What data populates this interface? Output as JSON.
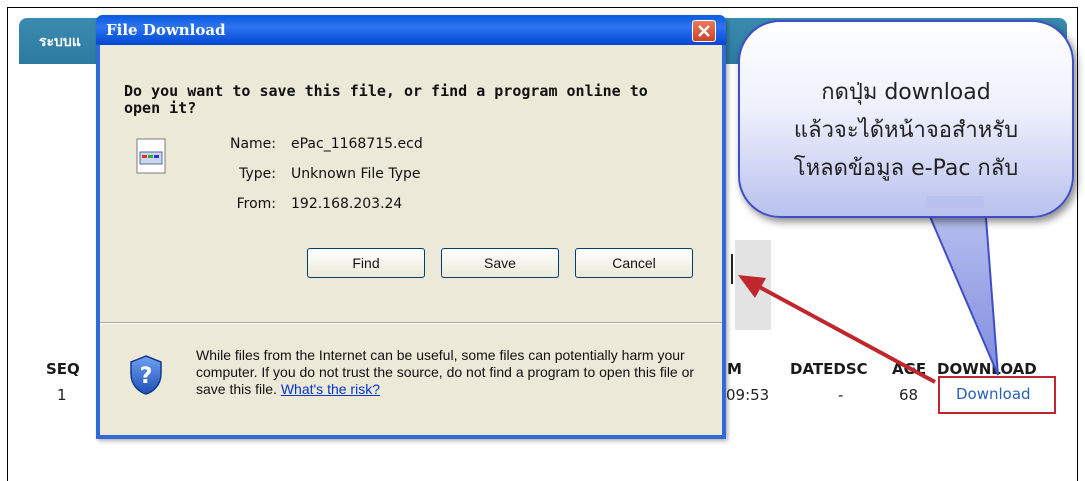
{
  "app": {
    "title_partial": "ระบบแ"
  },
  "table": {
    "headers": {
      "seq": "SEQ",
      "m": "M",
      "datedsc": "DATEDSC",
      "age": "AGE",
      "download": "DOWNLOAD"
    },
    "row": {
      "seq": "1",
      "time": "09:53",
      "datedsc": "-",
      "age": "68",
      "download": "Download"
    }
  },
  "callout": {
    "lines": [
      "กดปุ่ม download",
      "แล้วจะได้หน้าจอสำหรับ",
      "โหลดข้อมูล e-Pac กลับ"
    ]
  },
  "dialog": {
    "title": "File Download",
    "question": "Do you want to save this file, or find a program online to open it?",
    "fields": [
      {
        "label": "Name:",
        "value": "ePac_1168715.ecd"
      },
      {
        "label": "Type:",
        "value": "Unknown File Type"
      },
      {
        "label": "From:",
        "value": "192.168.203.24"
      }
    ],
    "buttons": {
      "find": "Find",
      "save": "Save",
      "cancel": "Cancel"
    },
    "warning": "While files from the Internet can be useful, some files can potentially harm your computer. If you do not trust the source, do not find a program to open this file or save this file.",
    "risk_link": "What's the risk?"
  },
  "colors": {
    "titlebar": "#0a5be0",
    "highlight_red": "#c0262d",
    "link_blue": "#2a5fb5",
    "callout_border": "#3f4fc4"
  }
}
